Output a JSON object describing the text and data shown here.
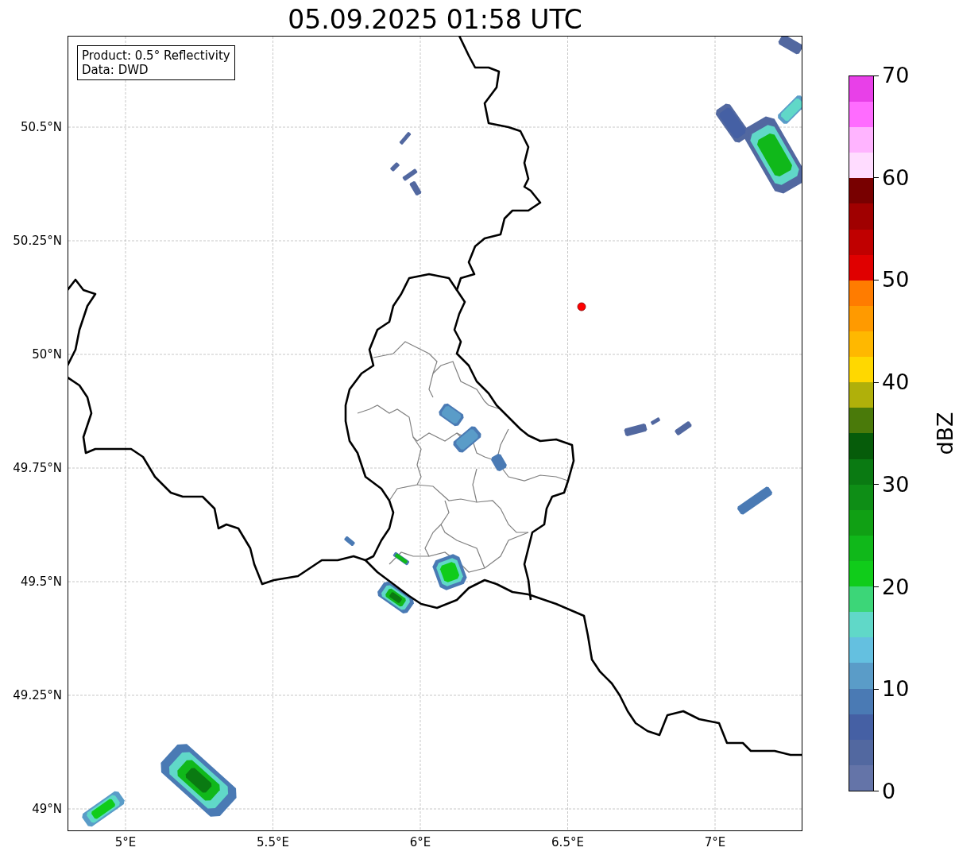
{
  "title": "05.09.2025 01:58 UTC",
  "legend": [
    "Product: 0.5° Reflectivity",
    "Data: DWD"
  ],
  "y_ticks": [
    "50.5°N",
    "50.25°N",
    "50°N",
    "49.75°N",
    "49.5°N",
    "49.25°N",
    "49°N"
  ],
  "x_ticks": [
    "5°E",
    "5.5°E",
    "6°E",
    "6.5°E",
    "7°E"
  ],
  "colorbar": {
    "label": "dBZ",
    "ticks": [
      "70",
      "60",
      "50",
      "40",
      "30",
      "20",
      "10",
      "0"
    ],
    "segments": [
      {
        "color": "#6474a8"
      },
      {
        "color": "#5268a0"
      },
      {
        "color": "#4560a4"
      },
      {
        "color": "#4a7ab4"
      },
      {
        "color": "#5a9cc8"
      },
      {
        "color": "#64c0e0"
      },
      {
        "color": "#60d8c8"
      },
      {
        "color": "#3cd678"
      },
      {
        "color": "#10cc1a"
      },
      {
        "color": "#10b81a"
      },
      {
        "color": "#10a014"
      },
      {
        "color": "#0e8e16"
      },
      {
        "color": "#0a7a12"
      },
      {
        "color": "#065c0a"
      },
      {
        "color": "#4a7a0a"
      },
      {
        "color": "#b0b00a"
      },
      {
        "color": "#ffd800"
      },
      {
        "color": "#ffb800"
      },
      {
        "color": "#ff9a00"
      },
      {
        "color": "#ff7c00"
      },
      {
        "color": "#e00000"
      },
      {
        "color": "#c00000"
      },
      {
        "color": "#a00000"
      },
      {
        "color": "#780000"
      },
      {
        "color": "#ffdcff"
      },
      {
        "color": "#ffb4ff"
      },
      {
        "color": "#ff6cff"
      },
      {
        "color": "#e840e8"
      }
    ]
  }
}
